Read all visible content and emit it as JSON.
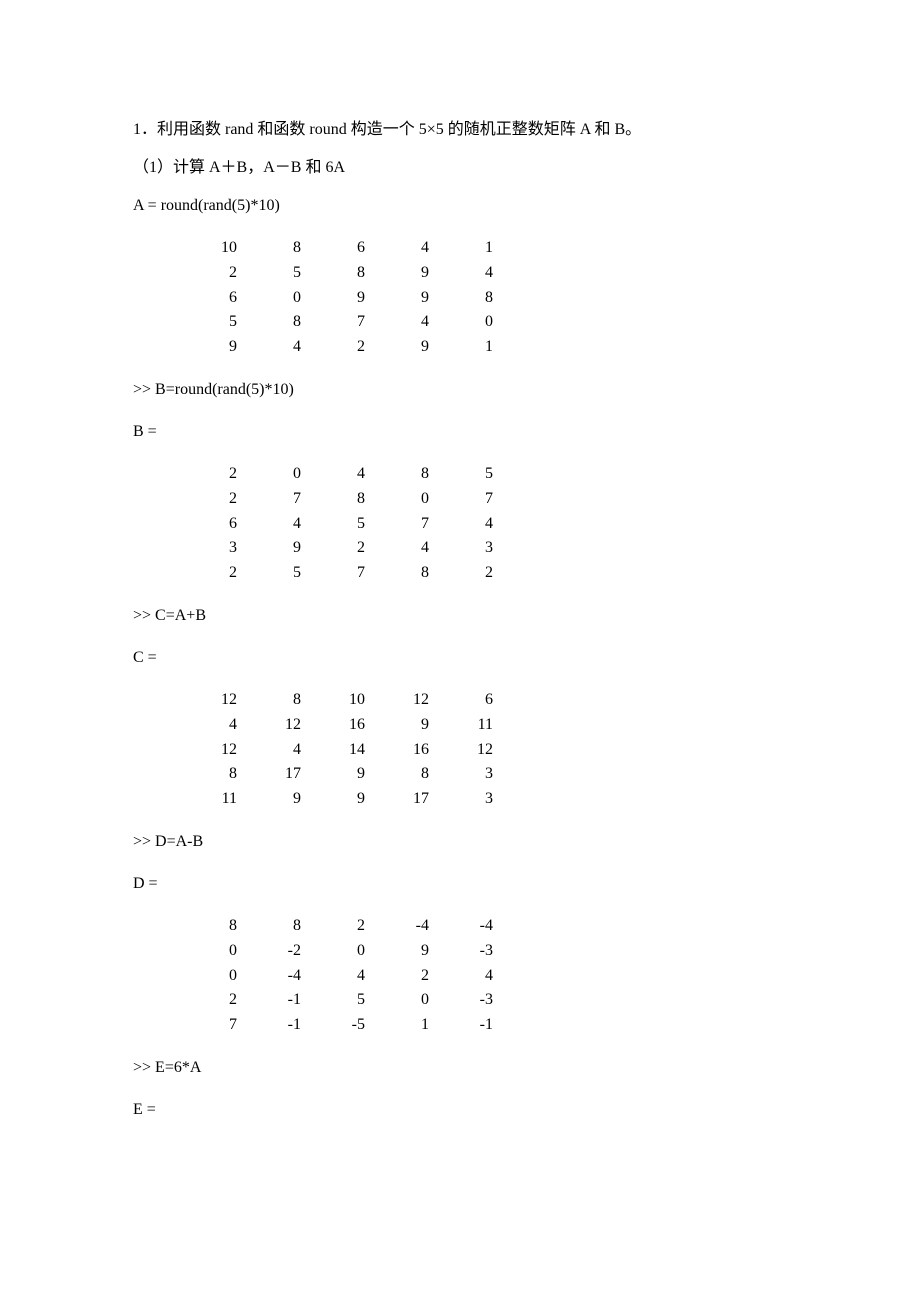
{
  "q1": "1．利用函数 rand 和函数 round 构造一个 5×5 的随机正整数矩阵 A 和 B。",
  "q1_1": "（1）计算 A＋B，A－B 和 6A",
  "cmdA": "A = round(rand(5)*10)",
  "cmdB": ">> B=round(rand(5)*10)",
  "lblB": "B =",
  "cmdC": ">> C=A+B",
  "lblC": "C =",
  "cmdD": ">> D=A-B",
  "lblD": "D =",
  "cmdE": ">> E=6*A",
  "lblE": "E =",
  "A": [
    [
      10,
      8,
      6,
      4,
      1
    ],
    [
      2,
      5,
      8,
      9,
      4
    ],
    [
      6,
      0,
      9,
      9,
      8
    ],
    [
      5,
      8,
      7,
      4,
      0
    ],
    [
      9,
      4,
      2,
      9,
      1
    ]
  ],
  "B": [
    [
      2,
      0,
      4,
      8,
      5
    ],
    [
      2,
      7,
      8,
      0,
      7
    ],
    [
      6,
      4,
      5,
      7,
      4
    ],
    [
      3,
      9,
      2,
      4,
      3
    ],
    [
      2,
      5,
      7,
      8,
      2
    ]
  ],
  "C": [
    [
      12,
      8,
      10,
      12,
      6
    ],
    [
      4,
      12,
      16,
      9,
      11
    ],
    [
      12,
      4,
      14,
      16,
      12
    ],
    [
      8,
      17,
      9,
      8,
      3
    ],
    [
      11,
      9,
      9,
      17,
      3
    ]
  ],
  "D": [
    [
      8,
      8,
      2,
      -4,
      -4
    ],
    [
      0,
      -2,
      0,
      9,
      -3
    ],
    [
      0,
      -4,
      4,
      2,
      4
    ],
    [
      2,
      -1,
      5,
      0,
      -3
    ],
    [
      7,
      -1,
      -5,
      1,
      -1
    ]
  ]
}
